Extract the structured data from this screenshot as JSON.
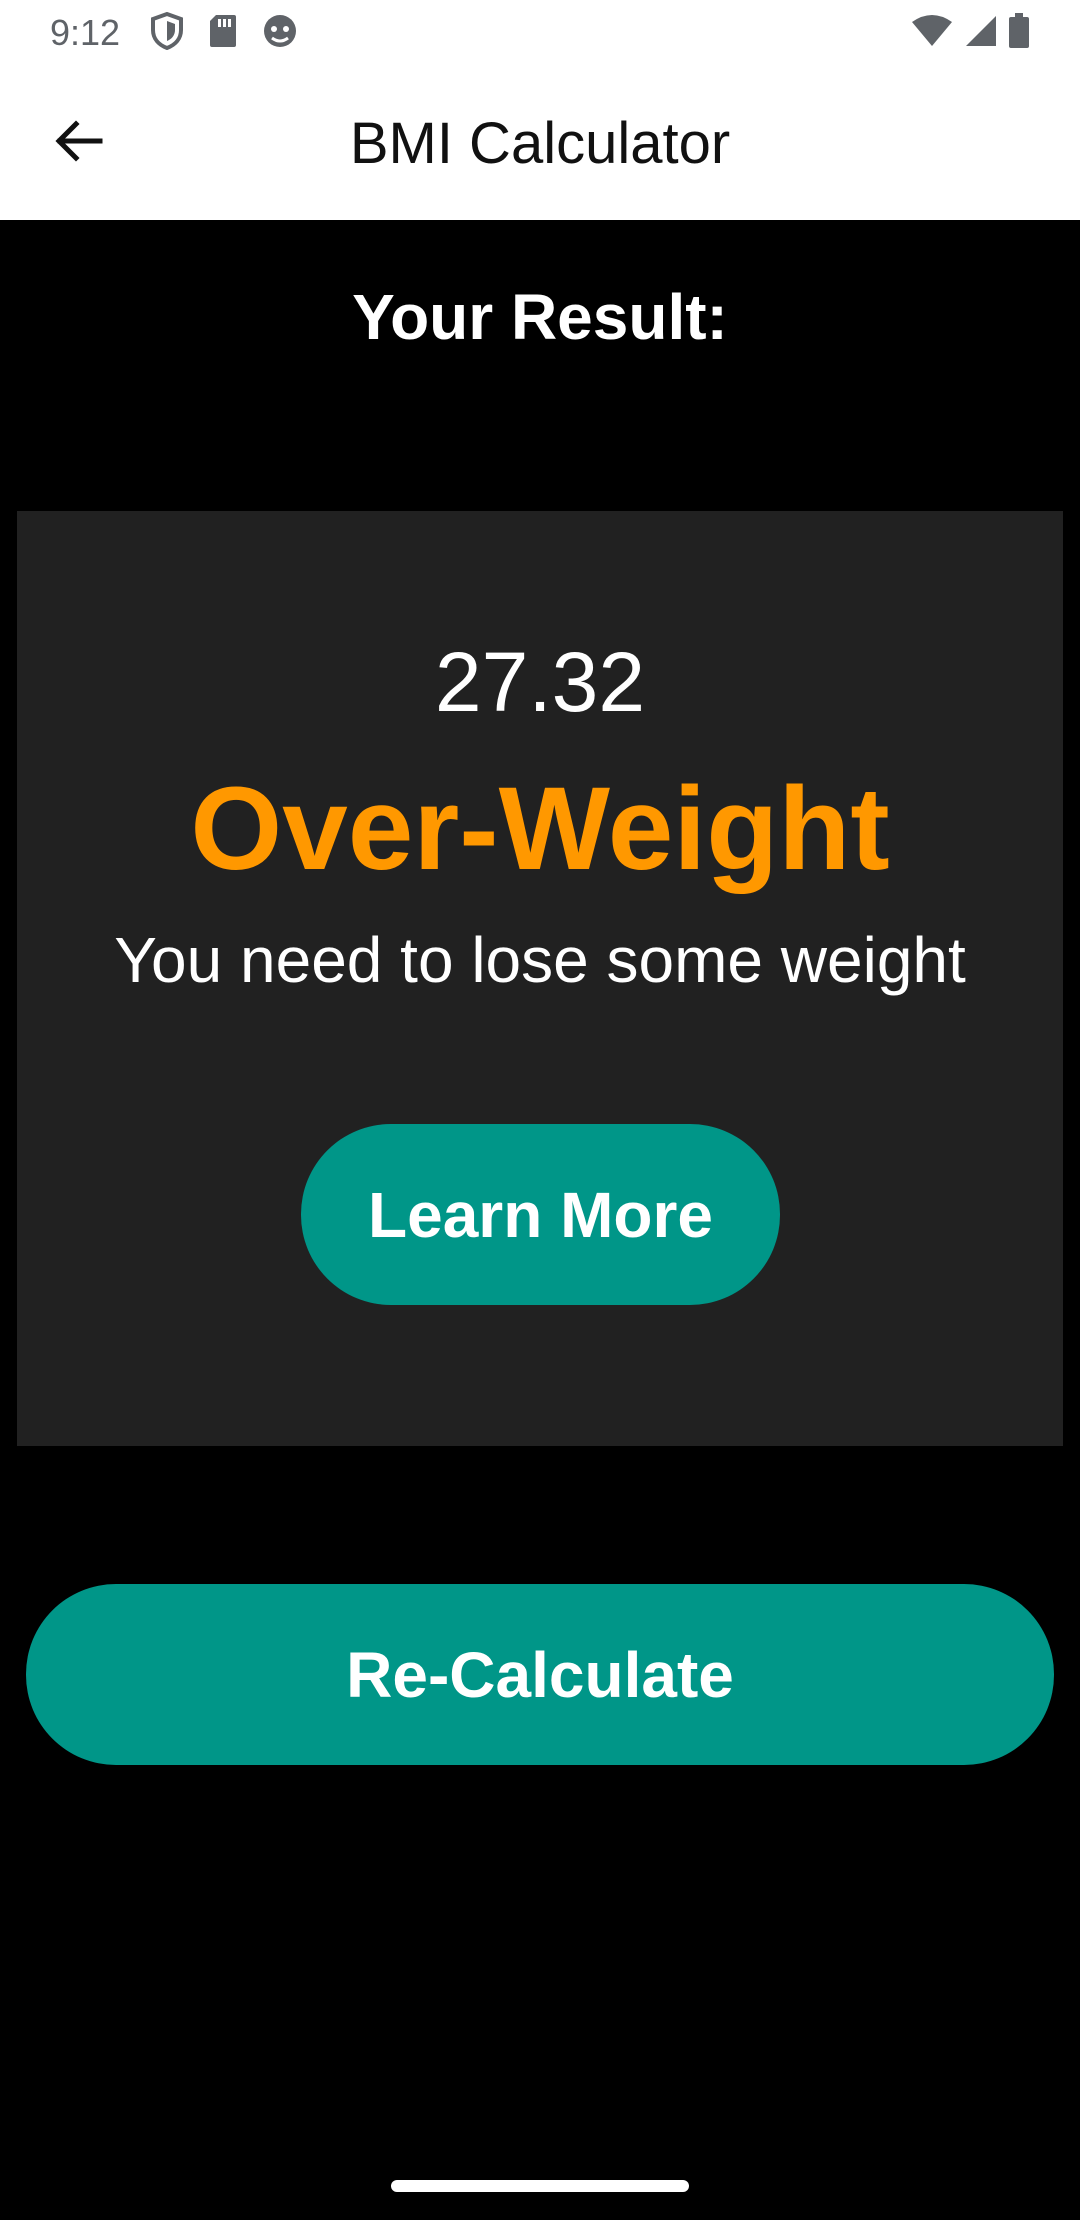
{
  "status_bar": {
    "time": "9:12",
    "left_icons": [
      "shield-icon",
      "sd-card-icon",
      "android-debug-icon"
    ],
    "right_icons": [
      "wifi-icon",
      "cellular-signal-icon",
      "battery-icon"
    ]
  },
  "app_bar": {
    "title": "BMI Calculator",
    "back_icon": "arrow-back-icon"
  },
  "result": {
    "heading": "Your Result:",
    "bmi_value": "27.32",
    "category": "Over-Weight",
    "advice": "You need to lose some weight",
    "learn_more_label": "Learn More"
  },
  "actions": {
    "recalculate_label": "Re-Calculate"
  },
  "colors": {
    "accent": "#009688",
    "category": "#ff9800",
    "card": "#212121",
    "background": "#000000"
  }
}
